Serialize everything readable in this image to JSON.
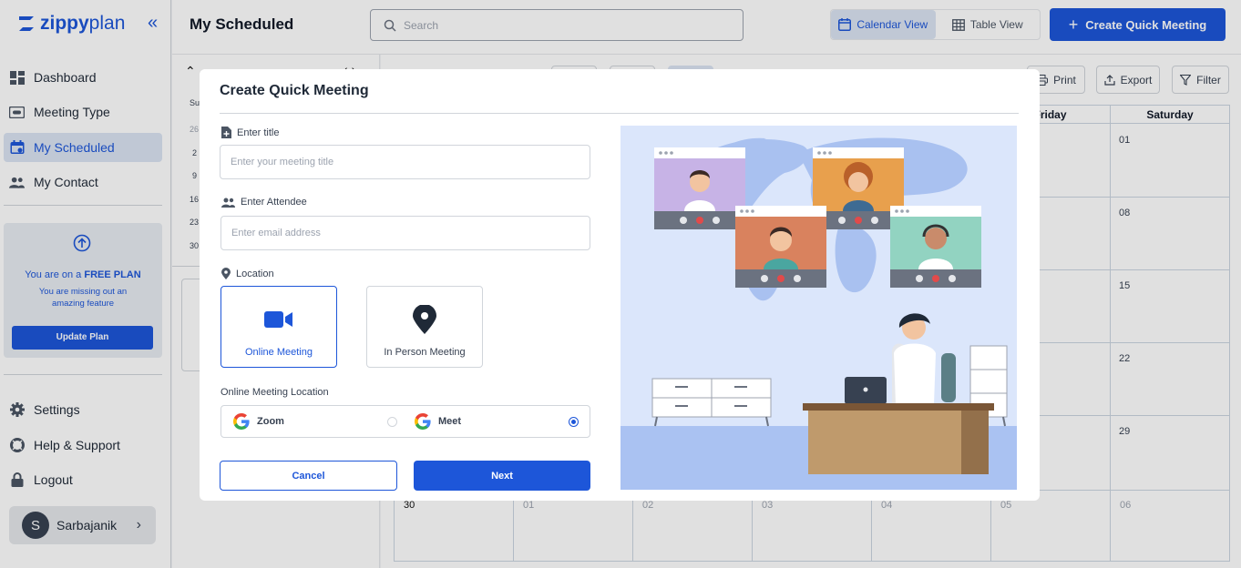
{
  "brand": {
    "logo_letter": "z",
    "name_bold": "zippy",
    "name_light": "plan"
  },
  "sidebar": {
    "items": [
      {
        "label": "Dashboard",
        "icon": "dashboard-icon"
      },
      {
        "label": "Meeting Type",
        "icon": "meeting-type-icon"
      },
      {
        "label": "My Scheduled",
        "icon": "calendar-icon",
        "active": true
      },
      {
        "label": "My Contact",
        "icon": "contacts-icon"
      }
    ],
    "upgrade": {
      "prefix": "You are on a ",
      "plan": "FREE PLAN",
      "message": "You are missing out an amazing feature",
      "button": "Update Plan"
    },
    "bottom_items": [
      {
        "label": "Settings",
        "icon": "gear-icon"
      },
      {
        "label": "Help & Support",
        "icon": "lifebuoy-icon"
      },
      {
        "label": "Logout",
        "icon": "lock-icon"
      }
    ],
    "user": {
      "initial": "S",
      "name": "Sarbajanik"
    }
  },
  "header": {
    "title": "My Scheduled",
    "search_placeholder": "Search",
    "views": [
      {
        "label": "Calendar View",
        "active": true
      },
      {
        "label": "Table View",
        "active": false
      }
    ],
    "create_button": "Create Quick Meeting"
  },
  "calendar": {
    "toolbar": {
      "print": "Print",
      "export": "Export",
      "filter": "Filter"
    },
    "visible_day_headers": [
      "Friday",
      "Saturday"
    ],
    "saturday_dates": [
      "01",
      "08",
      "15",
      "22",
      "29"
    ],
    "last_row_dates": [
      "30",
      "01",
      "02",
      "03",
      "04",
      "05",
      "06"
    ],
    "mini_day_header": "Su",
    "mini_dates": [
      "26",
      "2",
      "9",
      "16",
      "23",
      "30"
    ]
  },
  "modal": {
    "title": "Create Quick Meeting",
    "title_field": {
      "label": "Enter title",
      "placeholder": "Enter your meeting title",
      "value": ""
    },
    "attendee_field": {
      "label": "Enter Attendee",
      "placeholder": "Enter email address",
      "value": ""
    },
    "location": {
      "label": "Location",
      "options": [
        {
          "label": "Online Meeting",
          "selected": true
        },
        {
          "label": "In Person Meeting",
          "selected": false
        }
      ]
    },
    "online_location": {
      "label": "Online Meeting Location",
      "providers": [
        {
          "label": "Zoom",
          "selected": false
        },
        {
          "label": "Meet",
          "selected": true
        }
      ]
    },
    "cancel": "Cancel",
    "next": "Next"
  },
  "colors": {
    "primary": "#1d56d9",
    "active_bg": "#dbe4f3",
    "illustration_bg": "#dbe6fb"
  }
}
